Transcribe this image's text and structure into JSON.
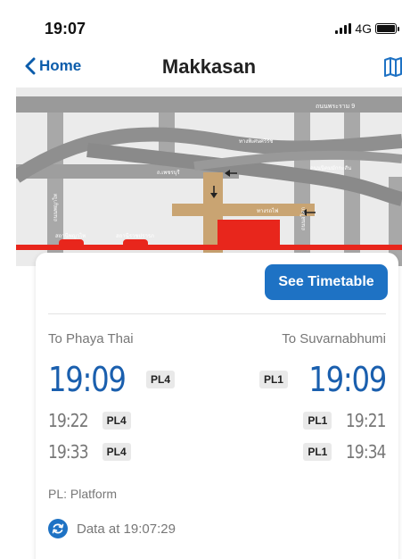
{
  "status_bar": {
    "time": "19:07",
    "network": "4G"
  },
  "nav": {
    "back_label": "Home",
    "title": "Makkasan"
  },
  "map": {
    "labels": [
      "ถนนพระราม 9",
      "ทางพิเศษศรีรัช",
      "ถนนนิคมมักกะสัน",
      "ถ.เพชรบุรี",
      "ถนนอโศก",
      "ทางรถไฟ",
      "สถานีพญาไท",
      "สถานีราชปรารภ"
    ]
  },
  "card": {
    "timetable_button": "See Timetable",
    "direction_left": "To Phaya Thai",
    "direction_right": "To Suvarnabhumi",
    "left_times": [
      {
        "time": "19:09",
        "platform": "PL4"
      },
      {
        "time": "19:22",
        "platform": "PL4"
      },
      {
        "time": "19:33",
        "platform": "PL4"
      }
    ],
    "right_times": [
      {
        "time": "19:09",
        "platform": "PL1"
      },
      {
        "time": "19:21",
        "platform": "PL1"
      },
      {
        "time": "19:34",
        "platform": "PL1"
      }
    ],
    "legend": "PL: Platform",
    "data_at": "Data at 19:07:29"
  },
  "colors": {
    "accent": "#1e72c4",
    "title_blue": "#1a5fae",
    "route_red": "#e8261c"
  }
}
